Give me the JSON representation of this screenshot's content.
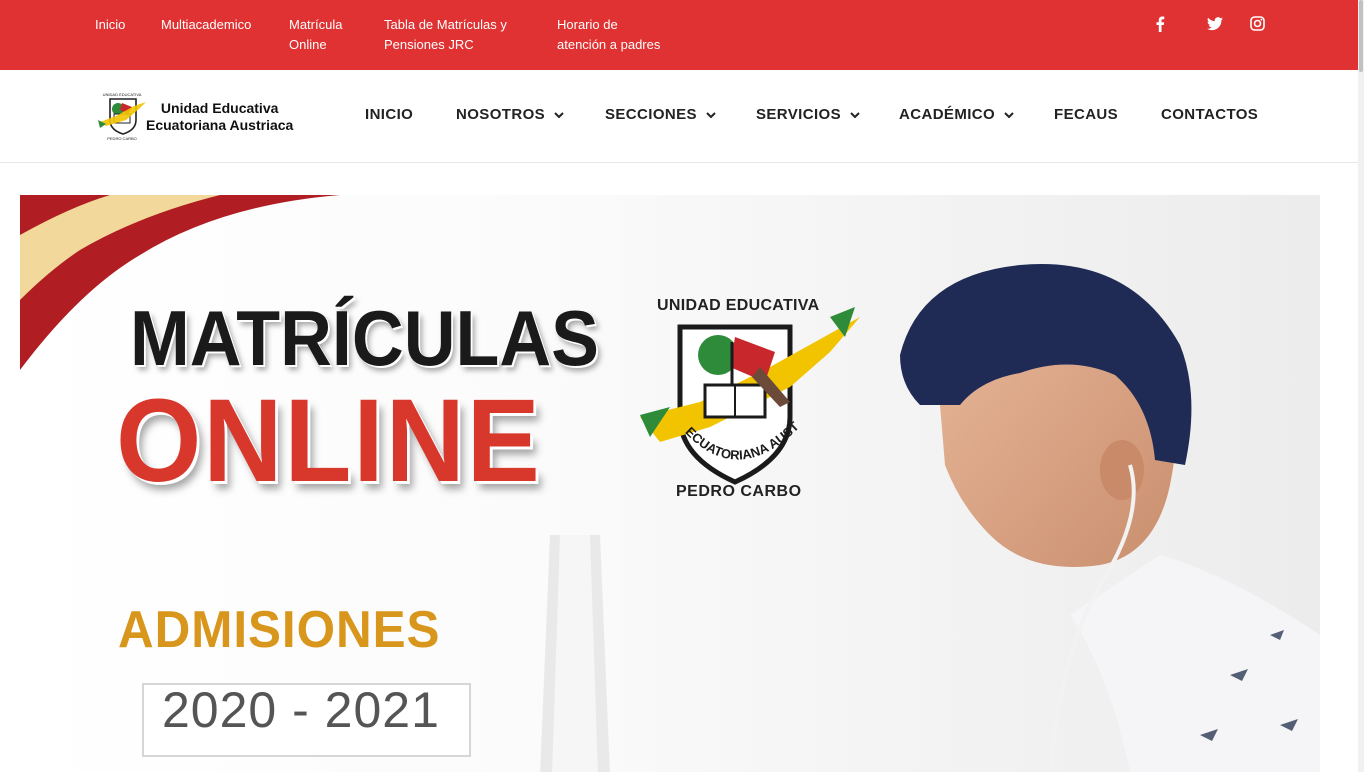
{
  "topbar": {
    "links": [
      {
        "line1": "Inicio",
        "line2": ""
      },
      {
        "line1": "Multiacademico",
        "line2": ""
      },
      {
        "line1": "Matrícula",
        "line2": "Online"
      },
      {
        "line1": "Tabla de Matrículas y",
        "line2": "Pensiones JRC"
      },
      {
        "line1": "Horario de",
        "line2": "atención a padres"
      }
    ],
    "social": [
      "facebook-icon",
      "twitter-icon",
      "instagram-icon"
    ],
    "background": "#e03232"
  },
  "header": {
    "brand": {
      "line1": "Unidad Educativa",
      "line2": "Ecuatoriana Austriaca"
    },
    "nav": [
      {
        "label": "INICIO",
        "dropdown": false
      },
      {
        "label": "NOSOTROS",
        "dropdown": true
      },
      {
        "label": "SECCIONES",
        "dropdown": true
      },
      {
        "label": "SERVICIOS",
        "dropdown": true
      },
      {
        "label": "ACADÉMICO",
        "dropdown": true
      },
      {
        "label": "FECAUS",
        "dropdown": false
      },
      {
        "label": "CONTACTOS",
        "dropdown": false
      }
    ]
  },
  "hero": {
    "title_line1": "MATRÍCULAS",
    "title_line2": "ONLINE",
    "school_name": "UNIDAD EDUCATIVA",
    "crest_arc_text": "ECUATORIANA AUSTRIACA",
    "place": "PEDRO CARBO",
    "admisiones": "ADMISIONES",
    "year": "2020 - 2021",
    "colors": {
      "red": "#d8382b",
      "gold": "#d8961c",
      "dark": "#1a1a1a"
    }
  }
}
